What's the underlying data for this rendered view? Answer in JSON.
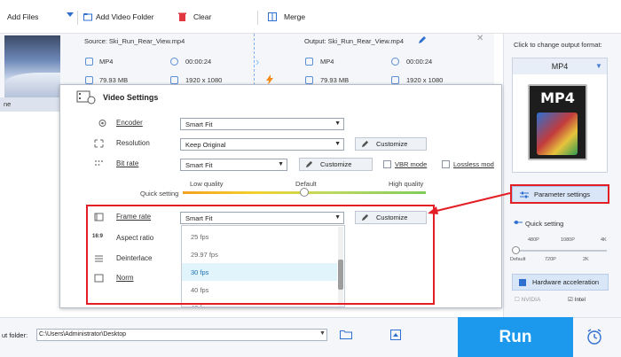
{
  "toolbar": {
    "add_files": "Add Files",
    "add_video_folder": "Add Video Folder",
    "clear": "Clear",
    "merge": "Merge"
  },
  "file": {
    "thumb_caption": "ne",
    "source_label": "Source: Ski_Run_Rear_View.mp4",
    "output_label": "Output: Ski_Run_Rear_View.mp4",
    "src_format": "MP4",
    "src_duration": "00:00:24",
    "src_size": "79.93 MB",
    "src_resolution": "1920 x 1080",
    "out_format": "MP4",
    "out_duration": "00:00:24",
    "out_size": "79.93 MB",
    "out_resolution": "1920 x 1080"
  },
  "right_panel": {
    "title": "Click to change output format:",
    "format": "MP4",
    "format_art_label": "MP4",
    "param_settings": "Parameter settings",
    "quick_setting": "Quick setting",
    "ticks_top": [
      "480P",
      "1080P",
      "4K"
    ],
    "ticks_bottom": [
      "Default",
      "720P",
      "2K"
    ],
    "hw_accel": "Hardware acceleration",
    "brand_nvidia": "NVIDIA",
    "brand_intel": "Intel"
  },
  "bottom": {
    "output_folder_label": "ut folder:",
    "output_folder_value": "C:\\Users\\Administrator\\Desktop",
    "run": "Run"
  },
  "dialog": {
    "title": "Video Settings",
    "encoder_label": "Encoder",
    "encoder_value": "Smart Fit",
    "resolution_label": "Resolution",
    "resolution_value": "Keep Original",
    "customize": "Customize",
    "bitrate_label": "Bit rate",
    "bitrate_value": "Smart Fit",
    "vbr_mode": "VBR mode",
    "lossless_mode": "Lossless mod",
    "quick_setting": "Quick setting",
    "low_quality": "Low quality",
    "default": "Default",
    "high_quality": "High quality",
    "quality_level": 0.5,
    "framerate_label": "Frame rate",
    "framerate_value": "Smart Fit",
    "aspect_label": "Aspect ratio",
    "deinterlace_label": "Deinterlace",
    "norm_label": "Norm",
    "fps_options": [
      "25 fps",
      "29.97 fps",
      "30 fps",
      "40 fps",
      "48 fps"
    ],
    "fps_selected": "30 fps"
  },
  "colors": {
    "run_button": "#1c98ec",
    "annotation_red": "#e31e24",
    "accent_blue": "#3a7fd6"
  }
}
